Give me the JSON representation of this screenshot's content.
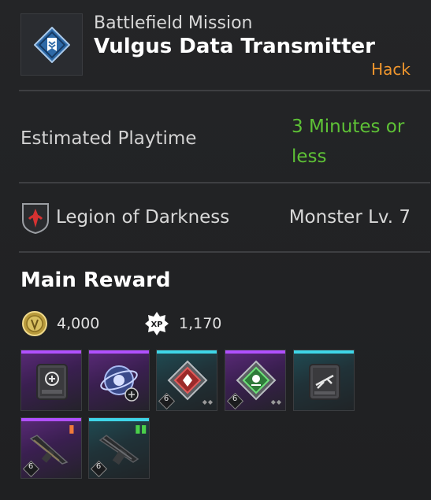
{
  "mission": {
    "type": "Battlefield Mission",
    "name": "Vulgus Data Transmitter",
    "tag": "Hack",
    "icon": "mission-diamond-icon"
  },
  "playtime": {
    "label": "Estimated Playtime",
    "value_line1": "3 Minutes or",
    "value_line2": "less"
  },
  "faction": {
    "icon": "legion-of-darkness-icon",
    "name": "Legion of Darkness",
    "monster_level": "Monster Lv. 7"
  },
  "reward": {
    "title": "Main Reward",
    "gold": "4,000",
    "xp_label": "XP",
    "xp": "1,170",
    "items": [
      {
        "icon": "data-module-icon",
        "rarity": "purple",
        "badge": ""
      },
      {
        "icon": "orb-sphere-icon",
        "rarity": "purple",
        "badge": ""
      },
      {
        "icon": "red-rune-icon",
        "rarity": "teal",
        "badge": "6"
      },
      {
        "icon": "green-rune-icon",
        "rarity": "purple",
        "badge": "6"
      },
      {
        "icon": "weapon-module-icon",
        "rarity": "teal",
        "badge": ""
      },
      {
        "icon": "assault-rifle-icon",
        "rarity": "purple",
        "badge": "6"
      },
      {
        "icon": "shotgun-icon",
        "rarity": "teal",
        "badge": "6"
      }
    ]
  },
  "colors": {
    "tag": "#f0962d",
    "playtime": "#5ec236",
    "purple_rarity": "#b150ff",
    "teal_rarity": "#3fd6e8"
  }
}
